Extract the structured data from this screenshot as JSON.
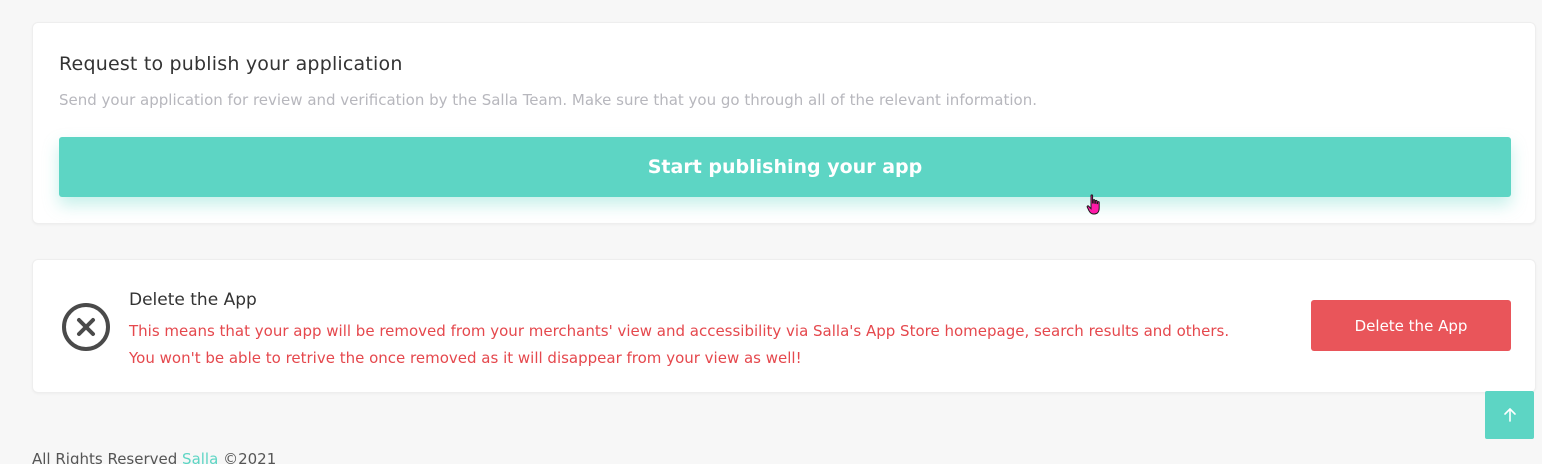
{
  "publish_section": {
    "title": "Request to publish your application",
    "description": "Send your application for review and verification by the Salla Team. Make sure that you go through all of the relevant information.",
    "button_label": "Start publishing your app"
  },
  "delete_section": {
    "icon": "circle-x-icon",
    "title": "Delete the App",
    "description_line1": "This means that your app will be removed from your merchants' view and accessibility via Salla's App Store homepage, search results and others.",
    "description_line2": "You won't be able to retrive the once removed as it will disappear from your view as well!",
    "button_label": "Delete the App"
  },
  "scroll_top": {
    "icon": "arrow-up-icon"
  },
  "footer": {
    "rights_text": "All Rights Reserved",
    "brand_link": "Salla",
    "copyright": "©2021"
  },
  "colors": {
    "accent": "#5dd5c4",
    "danger": "#e9555a",
    "danger_text": "#e5484d",
    "muted_text": "#b7b7bd"
  }
}
